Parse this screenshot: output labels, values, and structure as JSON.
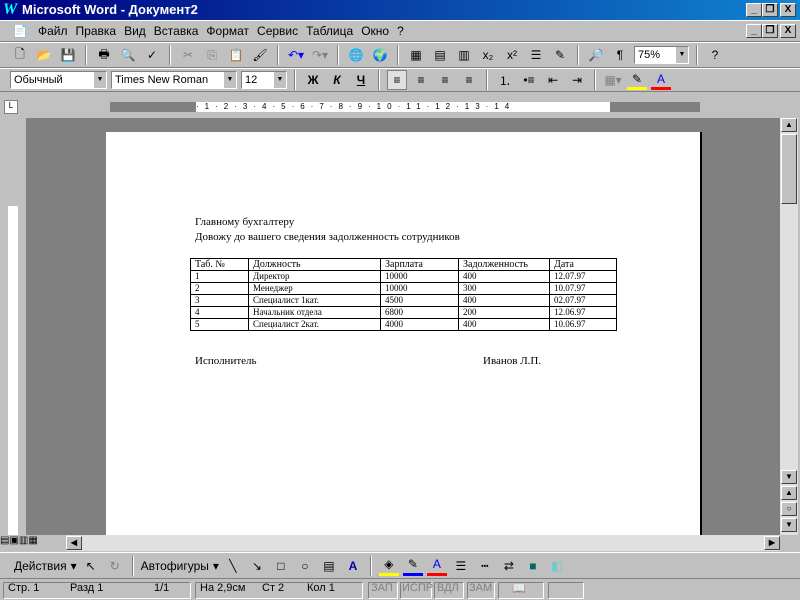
{
  "window": {
    "title": "Microsoft Word - Документ2"
  },
  "menu": [
    "Файл",
    "Правка",
    "Вид",
    "Вставка",
    "Формат",
    "Сервис",
    "Таблица",
    "Окно",
    "?"
  ],
  "toolbar": {
    "zoom": "75%"
  },
  "format": {
    "style": "Обычный",
    "font": "Times New Roman",
    "size": "12",
    "bold": "Ж",
    "italic": "К",
    "underline": "Ч"
  },
  "document": {
    "line1": "Главному бухгалтеру",
    "line2": "Довожу до вашего сведения задолженность сотрудников",
    "table": {
      "headers": [
        "Таб. №",
        "Должность",
        "Зарплата",
        "Задолженность",
        "Дата"
      ],
      "rows": [
        [
          "1",
          "Директор",
          "10000",
          "400",
          "12.07.97"
        ],
        [
          "2",
          "Менеджер",
          "10000",
          "300",
          "10.07.97"
        ],
        [
          "3",
          "Специалист 1кат.",
          "4500",
          "400",
          "02.07.97"
        ],
        [
          "4",
          "Начальник отдела",
          "6800",
          "200",
          "12.06.97"
        ],
        [
          "5",
          "Специалист 2кат.",
          "4000",
          "400",
          "10.06.97"
        ]
      ]
    },
    "signer_label": "Исполнитель",
    "signer_name": "Иванов Л.П."
  },
  "drawing": {
    "actions": "Действия",
    "autoshapes": "Автофигуры"
  },
  "status": {
    "page": "Стр. 1",
    "section": "Разд 1",
    "pages": "1/1",
    "at": "На 2,9см",
    "line": "Ст 2",
    "col": "Кол 1",
    "rec": "ЗАП",
    "trk": "ИСПР",
    "ext": "ВДЛ",
    "ovr": "ЗАМ"
  },
  "colors": {
    "title": "#000080",
    "highlight": "#ffff00",
    "font_color": "#ff0000"
  }
}
